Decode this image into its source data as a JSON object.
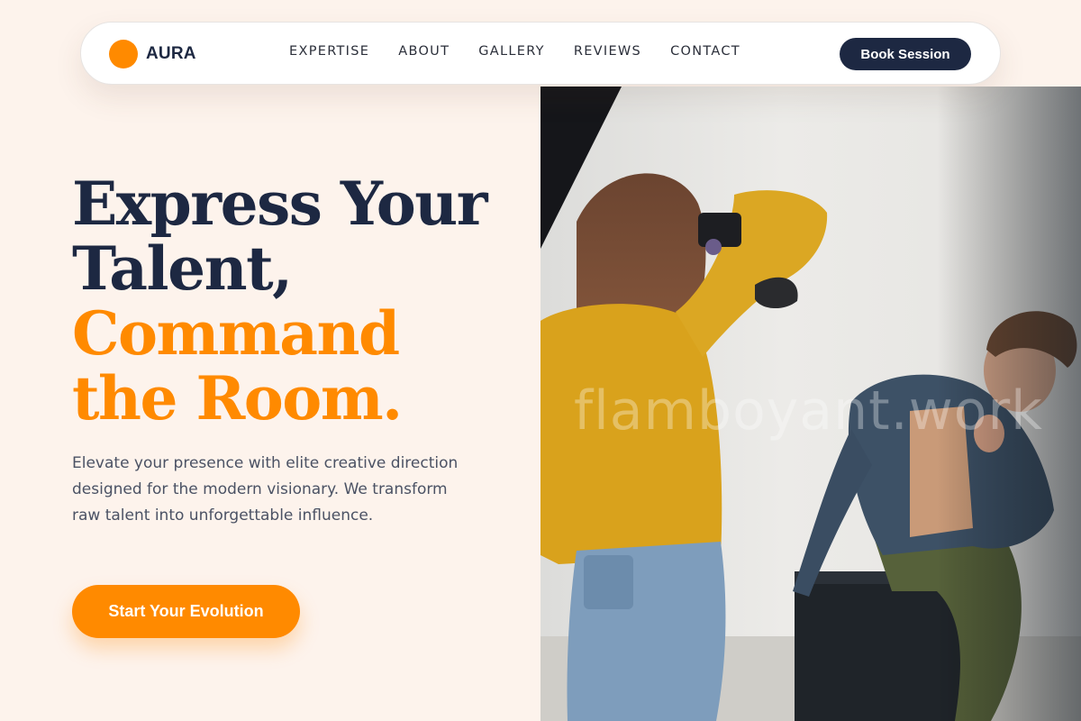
{
  "brand": {
    "name": "AURA",
    "accent_color": "#ff8a00",
    "dark_color": "#1d2842"
  },
  "nav": {
    "links": [
      "EXPERTISE",
      "ABOUT",
      "GALLERY",
      "REVIEWS",
      "CONTACT"
    ],
    "book_label": "Book Session"
  },
  "hero": {
    "headline_dark": [
      "Express Your",
      "Talent,"
    ],
    "headline_accent": [
      "Command",
      "the Room."
    ],
    "subtext": "Elevate your presence with elite creative direction designed for the modern visionary. We transform raw talent into unforgettable influence.",
    "cta_label": "Start Your Evolution",
    "image": {
      "watermark": "flamboyant.work"
    }
  }
}
